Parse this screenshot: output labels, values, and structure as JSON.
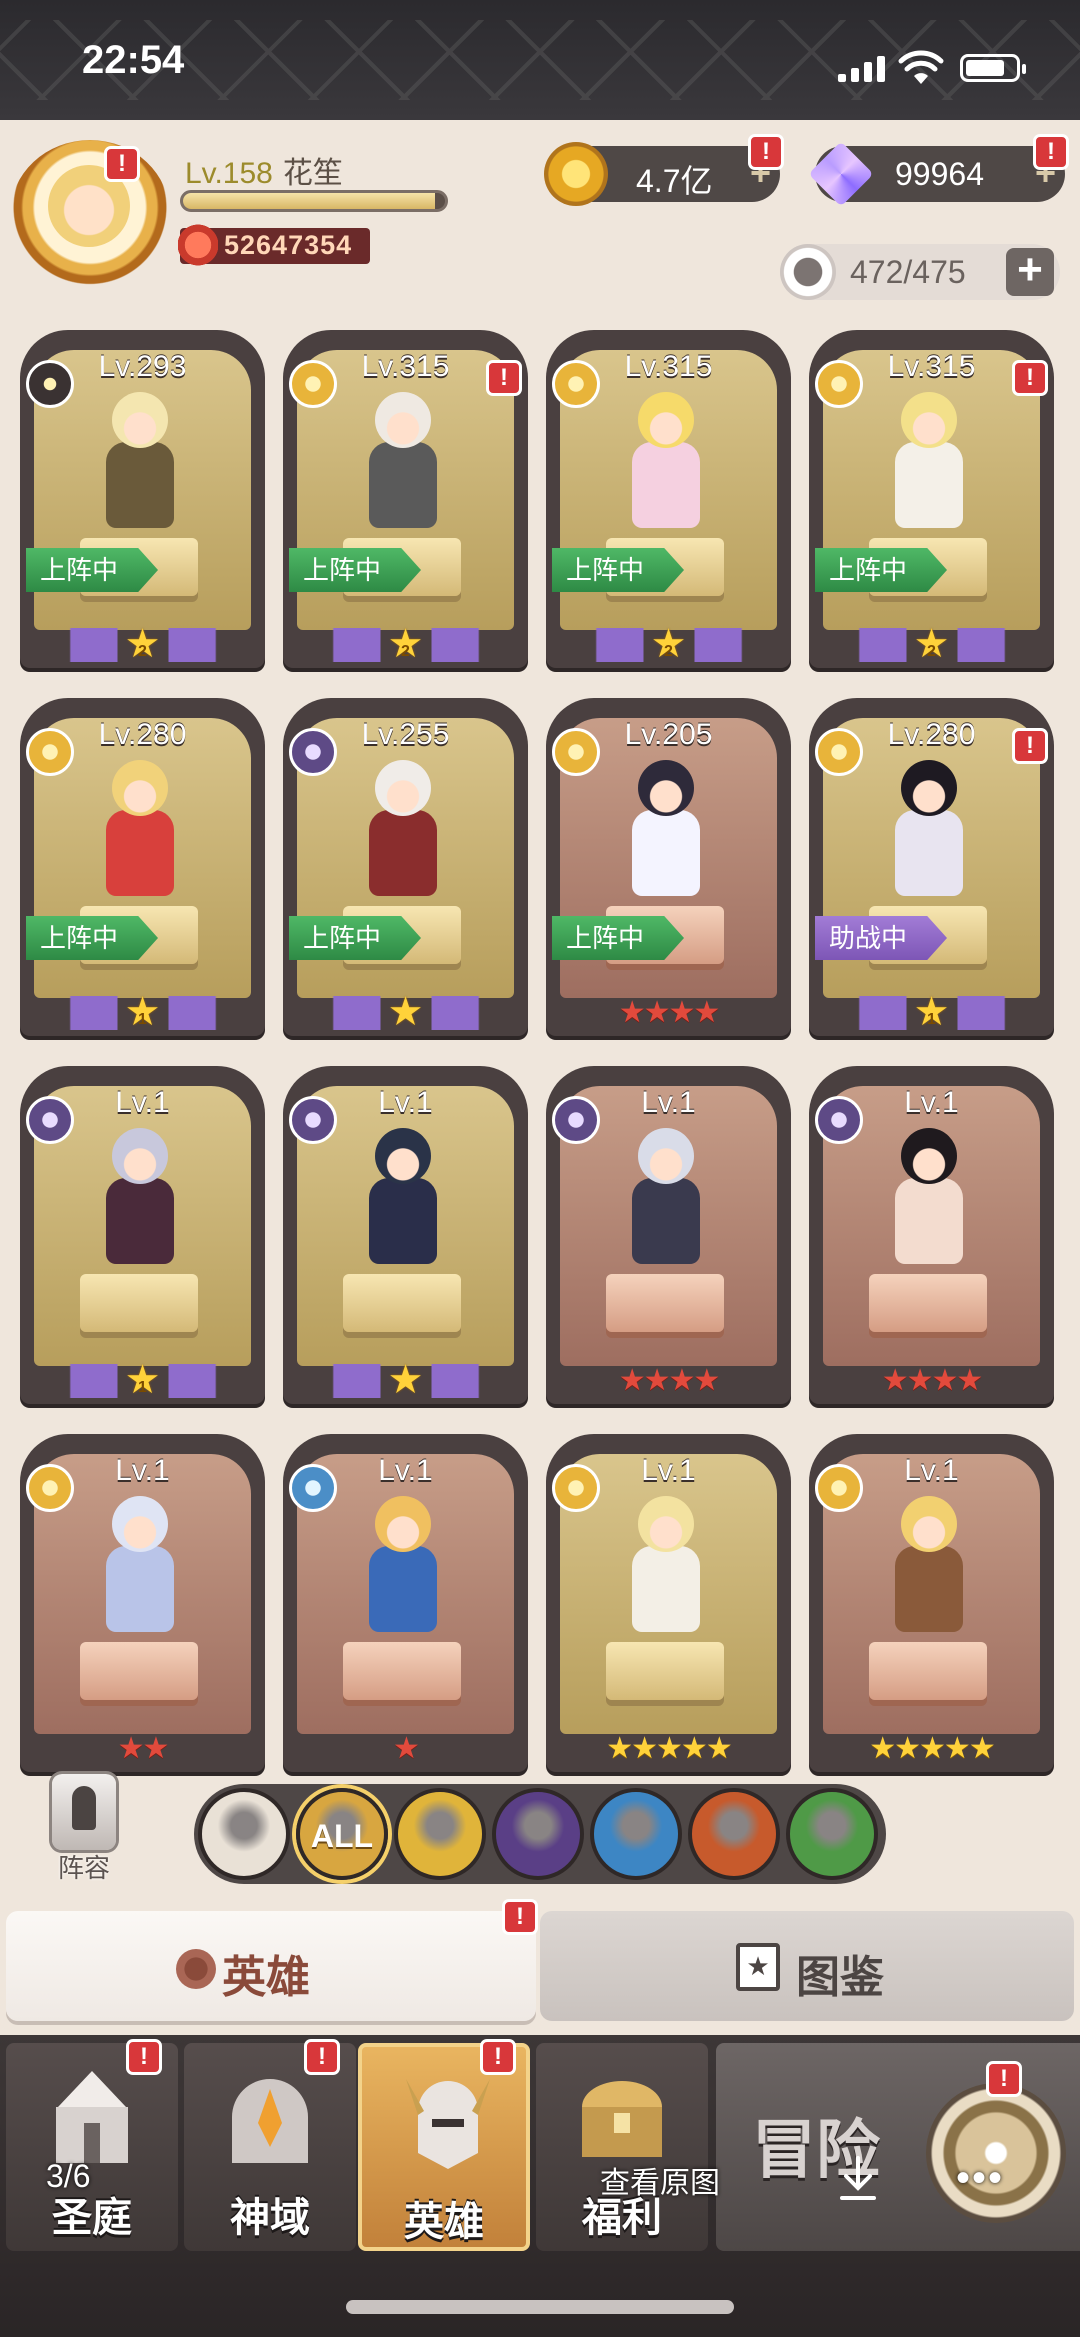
{
  "status_bar": {
    "time": "22:54"
  },
  "player": {
    "level": "Lv.158",
    "name": "花笙",
    "xp_fraction": 0.96,
    "power": "52647354",
    "avatar_badge": "!"
  },
  "resources": {
    "gold": "4.7亿",
    "diamonds": "99964",
    "stamina": "472/475",
    "plus": "+",
    "badge": "!"
  },
  "heroes": [
    {
      "level": "Lv.293",
      "faction": "dark-gold",
      "status": "上阵中",
      "rank": "wing",
      "stars": "2",
      "bg": "gold",
      "alert": false
    },
    {
      "level": "Lv.315",
      "faction": "gold",
      "status": "上阵中",
      "rank": "wing",
      "stars": "2",
      "bg": "gold",
      "alert": true
    },
    {
      "level": "Lv.315",
      "faction": "gold",
      "status": "上阵中",
      "rank": "wing",
      "stars": "2",
      "bg": "gold",
      "alert": false
    },
    {
      "level": "Lv.315",
      "faction": "gold",
      "status": "上阵中",
      "rank": "wing",
      "stars": "2",
      "bg": "gold",
      "alert": true
    },
    {
      "level": "Lv.280",
      "faction": "gold",
      "status": "上阵中",
      "rank": "wing",
      "stars": "1",
      "bg": "gold",
      "alert": false
    },
    {
      "level": "Lv.255",
      "faction": "purple",
      "status": "上阵中",
      "rank": "wing",
      "stars": "",
      "bg": "gold",
      "alert": false
    },
    {
      "level": "Lv.205",
      "faction": "gold",
      "status": "上阵中",
      "rank": "red",
      "stars": "★★★★",
      "bg": "red",
      "alert": false
    },
    {
      "level": "Lv.280",
      "faction": "gold",
      "status": "助战中",
      "rank": "wing",
      "stars": "1",
      "bg": "gold",
      "alert": true
    },
    {
      "level": "Lv.1",
      "faction": "purple",
      "status": "",
      "rank": "wing",
      "stars": "1",
      "bg": "gold",
      "alert": false
    },
    {
      "level": "Lv.1",
      "faction": "purple",
      "status": "",
      "rank": "wing",
      "stars": "",
      "bg": "gold",
      "alert": false
    },
    {
      "level": "Lv.1",
      "faction": "purple",
      "status": "",
      "rank": "red",
      "stars": "★★★★",
      "bg": "red",
      "alert": false
    },
    {
      "level": "Lv.1",
      "faction": "purple",
      "status": "",
      "rank": "red",
      "stars": "★★★★",
      "bg": "red",
      "alert": false
    },
    {
      "level": "Lv.1",
      "faction": "gold",
      "status": "",
      "rank": "red",
      "stars": "★★",
      "bg": "red",
      "alert": false
    },
    {
      "level": "Lv.1",
      "faction": "blue",
      "status": "",
      "rank": "red",
      "stars": "★",
      "bg": "red",
      "alert": false
    },
    {
      "level": "Lv.1",
      "faction": "gold",
      "status": "",
      "rank": "yellow",
      "stars": "★★★★★",
      "bg": "gold",
      "alert": false
    },
    {
      "level": "Lv.1",
      "faction": "gold",
      "status": "",
      "rank": "yellow",
      "stars": "★★★★★",
      "bg": "red",
      "alert": false
    }
  ],
  "lineup": {
    "label": "阵容"
  },
  "filters": [
    {
      "name": "up-arrow",
      "label": "",
      "color": "#e9e1d6"
    },
    {
      "name": "all",
      "label": "ALL",
      "color": "#d8a640"
    },
    {
      "name": "light",
      "label": "",
      "color": "#e0b43a"
    },
    {
      "name": "dark",
      "label": "",
      "color": "#5a3f86"
    },
    {
      "name": "sword",
      "label": "",
      "color": "#3d86c4"
    },
    {
      "name": "wolf",
      "label": "",
      "color": "#c75a2c"
    },
    {
      "name": "tree",
      "label": "",
      "color": "#4f9a47"
    }
  ],
  "tabs": {
    "hero": "英雄",
    "codex": "图鉴",
    "badge": "!"
  },
  "nav": [
    {
      "label": "圣庭",
      "badge": "!"
    },
    {
      "label": "神域",
      "badge": "!"
    },
    {
      "label": "英雄",
      "badge": "!"
    },
    {
      "label": "福利",
      "badge": ""
    },
    {
      "label": "冒险",
      "badge": "!"
    }
  ],
  "viewer": {
    "counter": "3/6",
    "view_original": "查看原图",
    "more": "•••"
  }
}
